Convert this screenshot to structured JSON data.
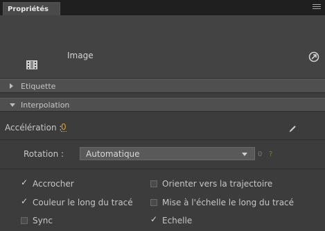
{
  "tab": {
    "label": "Propriétés"
  },
  "instance": {
    "name": "Image",
    "symbol_icon": "film-strip-icon",
    "swap_icon": "swap-symbol-icon"
  },
  "sections": [
    {
      "label": "Etiquette",
      "expanded": false
    },
    {
      "label": "Interpolation",
      "expanded": true
    }
  ],
  "interpolation": {
    "acceleration_label": "Accélération :",
    "acceleration_value": "0",
    "rotation_label": "Rotation :",
    "rotation_value": "Automatique",
    "rotation_count": "0"
  },
  "checkboxes": [
    {
      "label": "Accrocher",
      "checked": true
    },
    {
      "label": "Orienter vers la trajectoire",
      "checked": false
    },
    {
      "label": "Couleur le long du tracé",
      "checked": true
    },
    {
      "label": "Mise à l'échelle le long du tracé",
      "checked": false
    },
    {
      "label": "Sync",
      "checked": false
    },
    {
      "label": "Echelle",
      "checked": true
    }
  ],
  "colors": {
    "accent": "#e0a020",
    "panel": "#3c3c3c",
    "header": "#434343"
  }
}
